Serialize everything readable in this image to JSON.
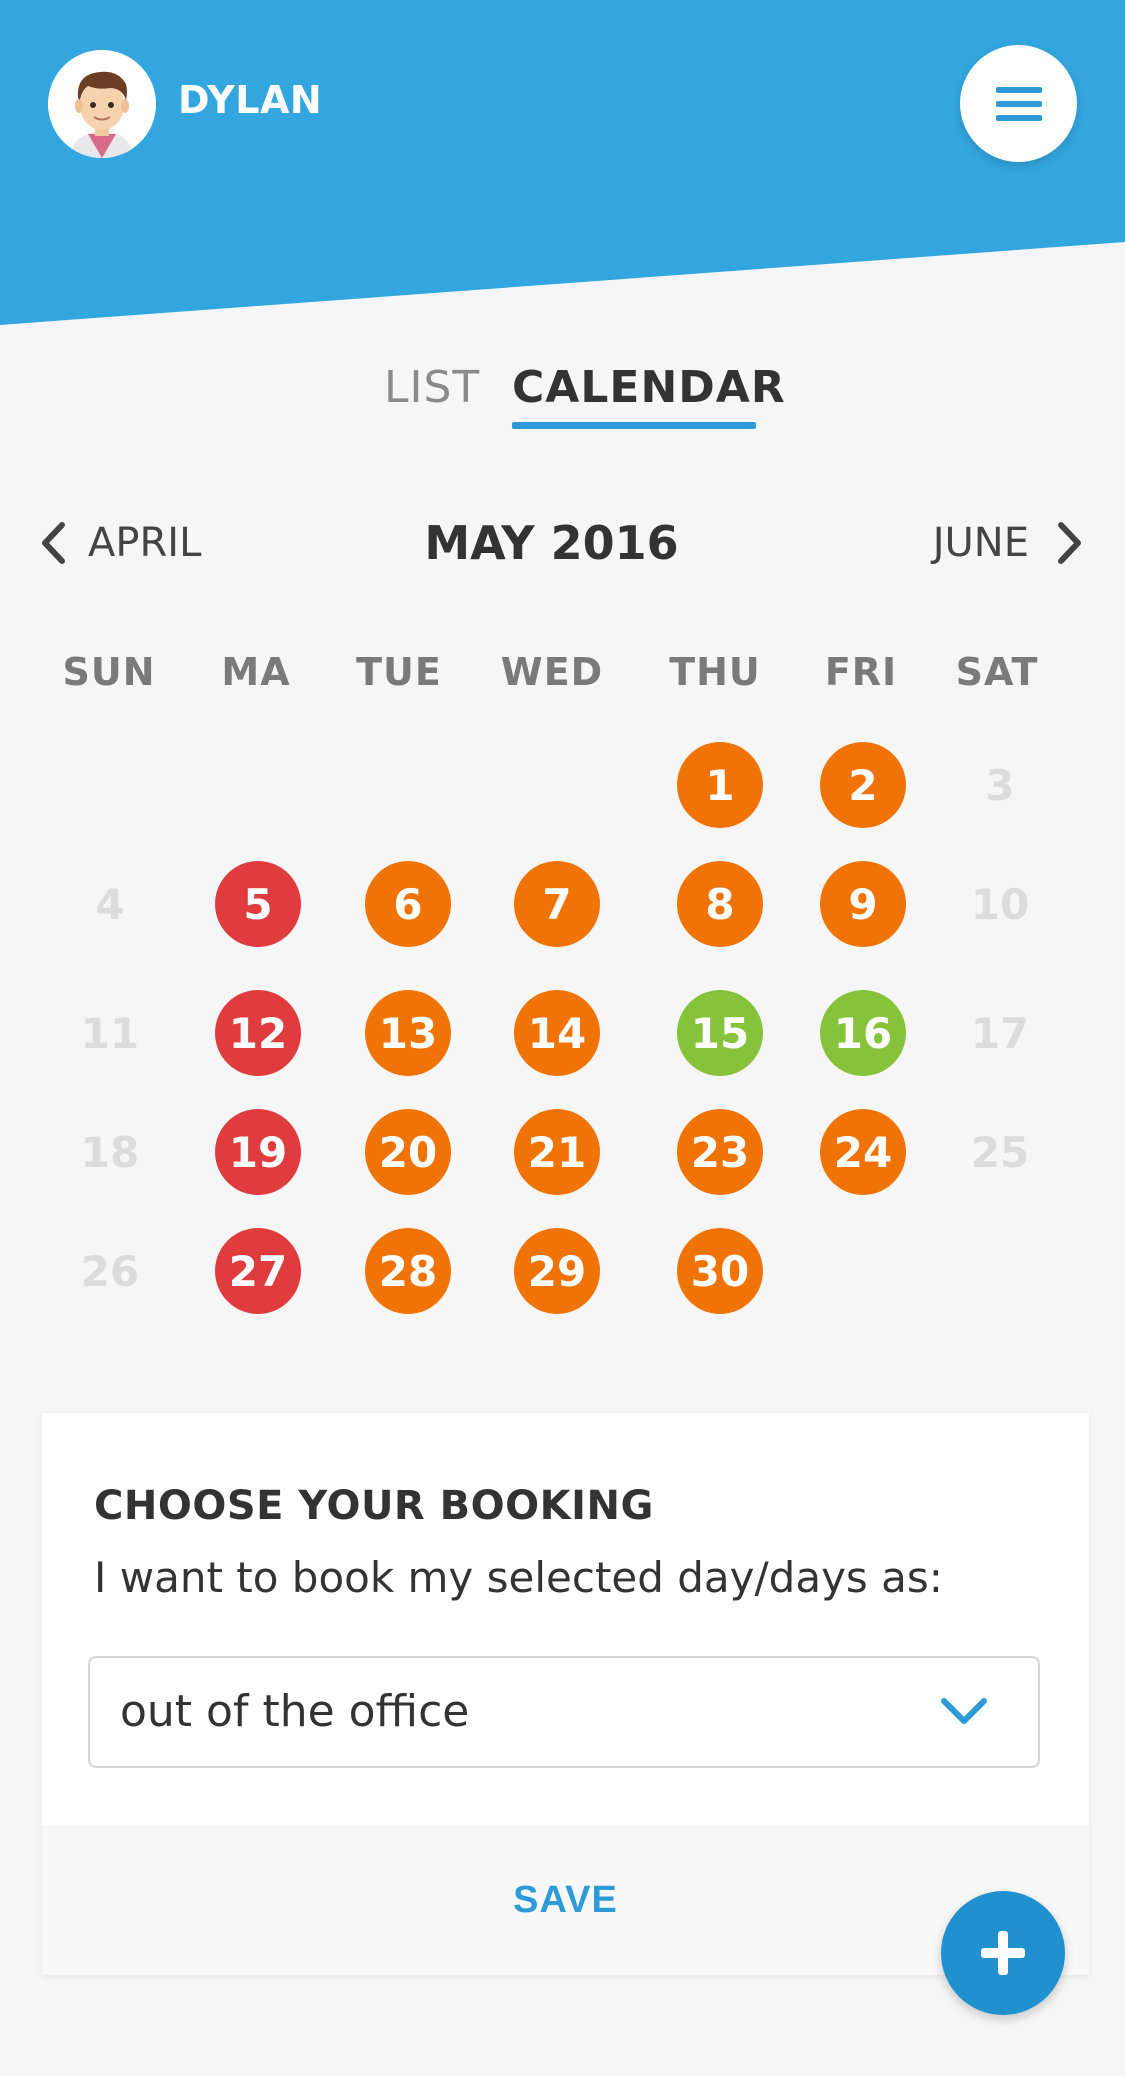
{
  "header": {
    "username": "DYLAN",
    "brand_color": "#33a6df",
    "menu_icon": "hamburger-icon"
  },
  "tabs": [
    {
      "label": "LIST",
      "active": false
    },
    {
      "label": "CALENDAR",
      "active": true
    }
  ],
  "calendar": {
    "prev_label": "APRIL",
    "next_label": "JUNE",
    "title": "MAY 2016",
    "weekdays": [
      "SUN",
      "MA",
      "TUE",
      "WED",
      "THU",
      "FRI",
      "SAT"
    ],
    "status_colors": {
      "orange": "#f07306",
      "red": "#e03c3e",
      "green": "#86c33a",
      "empty": "#dcdcdc"
    },
    "weeks": [
      [
        null,
        null,
        null,
        null,
        {
          "d": "1",
          "s": "orange"
        },
        {
          "d": "2",
          "s": "orange"
        },
        {
          "d": "3",
          "s": "empty"
        }
      ],
      [
        {
          "d": "4",
          "s": "empty"
        },
        {
          "d": "5",
          "s": "red"
        },
        {
          "d": "6",
          "s": "orange"
        },
        {
          "d": "7",
          "s": "orange"
        },
        {
          "d": "8",
          "s": "orange"
        },
        {
          "d": "9",
          "s": "orange"
        },
        {
          "d": "10",
          "s": "empty"
        }
      ],
      [
        {
          "d": "11",
          "s": "empty"
        },
        {
          "d": "12",
          "s": "red"
        },
        {
          "d": "13",
          "s": "orange"
        },
        {
          "d": "14",
          "s": "orange"
        },
        {
          "d": "15",
          "s": "green"
        },
        {
          "d": "16",
          "s": "green"
        },
        {
          "d": "17",
          "s": "empty"
        }
      ],
      [
        {
          "d": "18",
          "s": "empty"
        },
        {
          "d": "19",
          "s": "red"
        },
        {
          "d": "20",
          "s": "orange"
        },
        {
          "d": "21",
          "s": "orange"
        },
        {
          "d": "23",
          "s": "orange"
        },
        {
          "d": "24",
          "s": "orange"
        },
        {
          "d": "25",
          "s": "empty"
        }
      ],
      [
        {
          "d": "26",
          "s": "empty"
        },
        {
          "d": "27",
          "s": "red"
        },
        {
          "d": "28",
          "s": "orange"
        },
        {
          "d": "29",
          "s": "orange"
        },
        {
          "d": "30",
          "s": "orange"
        },
        null,
        null
      ]
    ]
  },
  "booking": {
    "title": "CHOOSE YOUR BOOKING",
    "subtitle": "I want to book my selected day/days as:",
    "selected_value": "out of the office",
    "save_label": "SAVE"
  },
  "fab": {
    "icon": "plus-icon"
  }
}
